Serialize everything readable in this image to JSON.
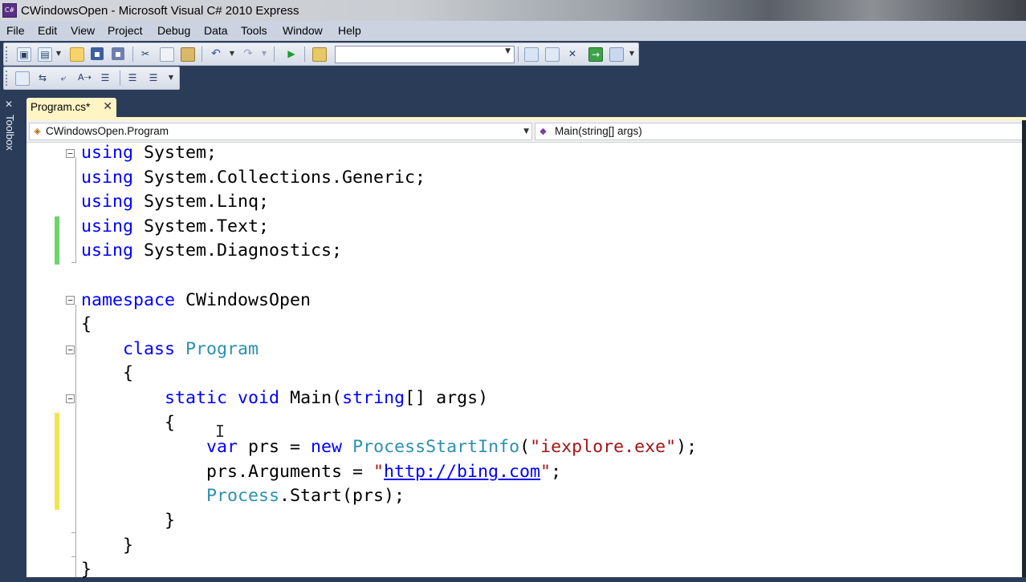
{
  "window": {
    "title": "CWindowsOpen - Microsoft Visual C# 2010 Express",
    "app_icon_label": "C#"
  },
  "menu": [
    "File",
    "Edit",
    "View",
    "Project",
    "Debug",
    "Data",
    "Tools",
    "Window",
    "Help"
  ],
  "toolbar": {
    "icons": [
      "new-project-icon",
      "add-item-icon",
      "open-file-icon",
      "save-icon",
      "save-all-icon",
      "cut-icon",
      "copy-icon",
      "paste-icon",
      "undo-icon",
      "redo-icon",
      "start-debugging-icon",
      "find-in-files-icon",
      "solution-explorer-icon",
      "properties-icon",
      "toolbox-icon",
      "object-browser-icon",
      "start-page-icon"
    ],
    "find_combo_value": ""
  },
  "toolbox": {
    "label": "Toolbox"
  },
  "tab": {
    "name": "Program.cs*",
    "close": "✕"
  },
  "navigation": {
    "type_combo": "CWindowsOpen.Program",
    "member_combo": "Main(string[] args)"
  },
  "code_lines": [
    [
      {
        "t": "using",
        "c": "kw"
      },
      {
        "t": " System;"
      }
    ],
    [
      {
        "t": "using",
        "c": "kw"
      },
      {
        "t": " System.Collections.Generic;"
      }
    ],
    [
      {
        "t": "using",
        "c": "kw"
      },
      {
        "t": " System.Linq;"
      }
    ],
    [
      {
        "t": "using",
        "c": "kw"
      },
      {
        "t": " System.Text;"
      }
    ],
    [
      {
        "t": "using",
        "c": "kw"
      },
      {
        "t": " System.Diagnostics;"
      }
    ],
    [],
    [
      {
        "t": "namespace",
        "c": "kw"
      },
      {
        "t": " CWindowsOpen"
      }
    ],
    [
      {
        "t": "{"
      }
    ],
    [
      {
        "t": "    "
      },
      {
        "t": "class",
        "c": "kw"
      },
      {
        "t": " "
      },
      {
        "t": "Program",
        "c": "ty"
      }
    ],
    [
      {
        "t": "    {"
      }
    ],
    [
      {
        "t": "        "
      },
      {
        "t": "static",
        "c": "kw"
      },
      {
        "t": " "
      },
      {
        "t": "void",
        "c": "kw"
      },
      {
        "t": " Main("
      },
      {
        "t": "string",
        "c": "kw"
      },
      {
        "t": "[] args)"
      }
    ],
    [
      {
        "t": "        {"
      }
    ],
    [
      {
        "t": "            "
      },
      {
        "t": "var",
        "c": "kw"
      },
      {
        "t": " prs = "
      },
      {
        "t": "new",
        "c": "kw"
      },
      {
        "t": " "
      },
      {
        "t": "ProcessStartInfo",
        "c": "ty"
      },
      {
        "t": "("
      },
      {
        "t": "\"iexplore.exe\"",
        "c": "st"
      },
      {
        "t": ");"
      }
    ],
    [
      {
        "t": "            prs.Arguments = "
      },
      {
        "t": "\"",
        "c": "st"
      },
      {
        "t": "http://bing.com",
        "c": "url"
      },
      {
        "t": "\"",
        "c": "st"
      },
      {
        "t": ";"
      }
    ],
    [
      {
        "t": "            "
      },
      {
        "t": "Process",
        "c": "ty"
      },
      {
        "t": ".Start(prs);"
      }
    ],
    [
      {
        "t": "        }"
      }
    ],
    [
      {
        "t": "    }"
      }
    ],
    [
      {
        "t": "}"
      }
    ]
  ],
  "colors": {
    "keyword": "#0000ff",
    "type": "#2b91af",
    "string": "#a31515",
    "saved_change": "#6ad66a",
    "unsaved_change": "#f2e552"
  }
}
